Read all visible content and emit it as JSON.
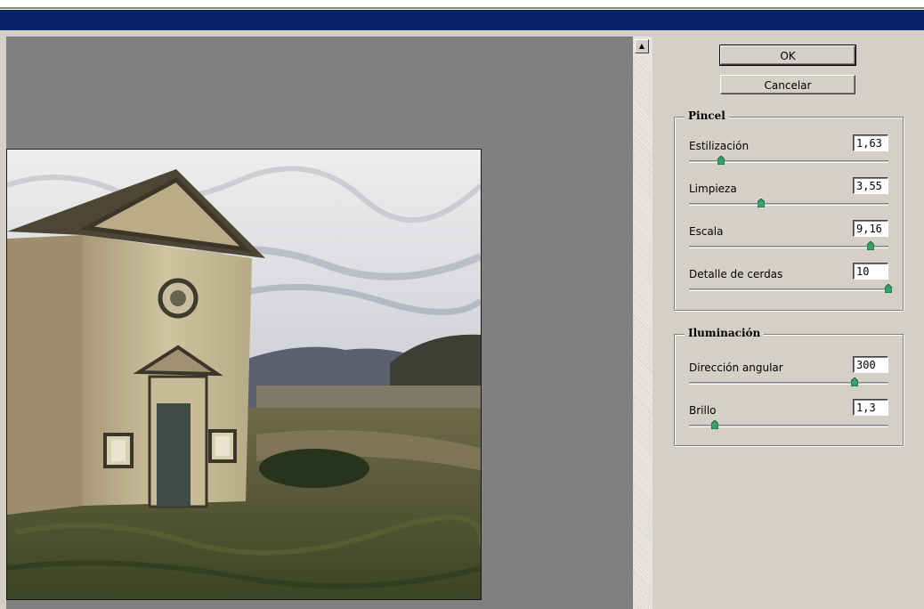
{
  "window": {
    "buttons": {
      "ok_label": "OK",
      "cancel_label": "Cancelar"
    }
  },
  "pincel": {
    "legend": "Pincel",
    "params": [
      {
        "label": "Estilización",
        "value": "1,63",
        "slider": 0.16
      },
      {
        "label": "Limpieza",
        "value": "3,55",
        "slider": 0.36
      },
      {
        "label": "Escala",
        "value": "9,16",
        "slider": 0.91
      },
      {
        "label": "Detalle de cerdas",
        "value": "10",
        "slider": 1.0
      }
    ]
  },
  "iluminacion": {
    "legend": "Iluminación",
    "params": [
      {
        "label": "Dirección angular",
        "value": "300",
        "slider": 0.83
      },
      {
        "label": "Brillo",
        "value": "1,3",
        "slider": 0.13
      }
    ]
  },
  "colors": {
    "title_bar": "#0a246a",
    "dialog_bg": "#d4d0c8",
    "preview_bg": "#808080",
    "slider_thumb": "#3aa06a"
  },
  "icons": {
    "scroll_up": "scroll-up-arrow-icon",
    "slider_thumb": "slider-thumb-icon"
  }
}
